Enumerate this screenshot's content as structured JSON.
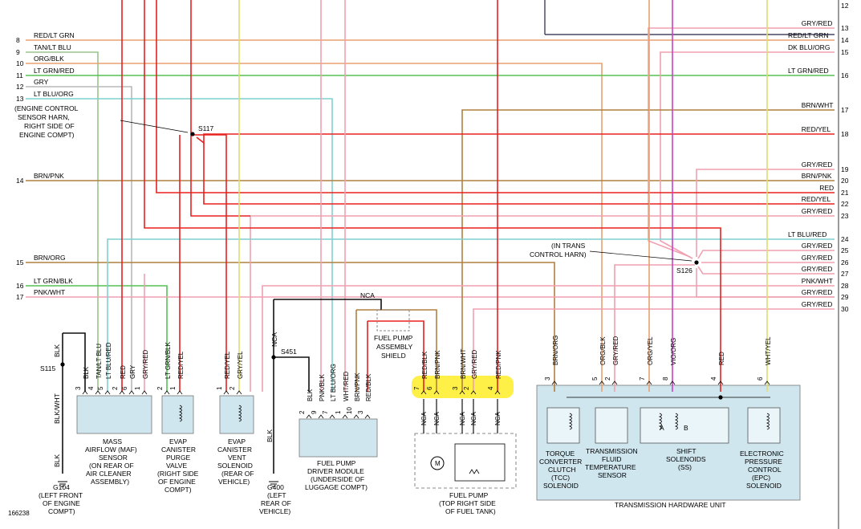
{
  "diagram_id": "166238",
  "colors": {
    "red": "#e8201f",
    "grn": "#55c255",
    "tan": "#9bc48a",
    "org": "#e8a070",
    "gry": "#b8b8b8",
    "blu": "#7ed0d0",
    "brn": "#b08040",
    "pnk": "#f0a0b0",
    "blk": "#111111",
    "vio": "#cc40cc",
    "yel": "#dede70",
    "box": "#cfe6ef",
    "highlight": "#ffee33",
    "dkblu": "#222244"
  },
  "left_wires": [
    {
      "num": "8",
      "label": "RED/LT GRN"
    },
    {
      "num": "9",
      "label": "TAN/LT BLU"
    },
    {
      "num": "10",
      "label": "ORG/BLK"
    },
    {
      "num": "11",
      "label": "LT GRN/RED"
    },
    {
      "num": "12",
      "label": "GRY"
    },
    {
      "num": "13",
      "label": "LT BLU/ORG"
    },
    {
      "num": "14",
      "label": "BRN/PNK"
    },
    {
      "num": "15",
      "label": "BRN/ORG"
    },
    {
      "num": "16",
      "label": "LT GRN/BLK"
    },
    {
      "num": "17",
      "label": "PNK/WHT"
    }
  ],
  "right_wires": [
    {
      "num": "12",
      "label": ""
    },
    {
      "num": "13",
      "label": "GRY/RED"
    },
    {
      "num": "14",
      "label": "RED/LT GRN"
    },
    {
      "num": "15",
      "label": "DK BLU/ORG"
    },
    {
      "num": "16",
      "label": "LT GRN/RED"
    },
    {
      "num": "17",
      "label": "BRN/WHT"
    },
    {
      "num": "18",
      "label": "RED/YEL"
    },
    {
      "num": "19",
      "label": "GRY/RED"
    },
    {
      "num": "20",
      "label": "BRN/PNK"
    },
    {
      "num": "21",
      "label": "RED"
    },
    {
      "num": "22",
      "label": "RED/YEL"
    },
    {
      "num": "23",
      "label": "GRY/RED"
    },
    {
      "num": "24",
      "label": "LT BLU/RED"
    },
    {
      "num": "25",
      "label": "GRY/RED"
    },
    {
      "num": "26",
      "label": "GRY/RED"
    },
    {
      "num": "27",
      "label": "GRY/RED"
    },
    {
      "num": "28",
      "label": "PNK/WHT"
    },
    {
      "num": "29",
      "label": "GRY/RED"
    },
    {
      "num": "30",
      "label": "GRY/RED"
    }
  ],
  "splices": {
    "s117": "S117",
    "s117_note": [
      "(ENGINE CONTROL",
      "SENSOR HARN,",
      "RIGHT SIDE OF",
      "ENGINE COMPT)"
    ],
    "s126": "S126",
    "s126_note": [
      "(IN TRANS",
      "CONTROL HARN)"
    ],
    "s115": "S115",
    "s451": "S451",
    "nca": "NCA"
  },
  "maf": {
    "pins": [
      {
        "num": "3",
        "wire": "BLK"
      },
      {
        "num": "4",
        "wire": "TAN/LT BLU"
      },
      {
        "num": "5",
        "wire": "LT BLU/RED"
      },
      {
        "num": "2",
        "wire": "RED"
      },
      {
        "num": "6",
        "wire": "GRY"
      },
      {
        "num": "1",
        "wire": "GRY/RED"
      }
    ],
    "caption": [
      "MASS",
      "AIRFLOW (MAF)",
      "SENSOR",
      "(ON REAR OF",
      "AIR CLEANER",
      "ASSEMBLY)"
    ]
  },
  "purge": {
    "pins": [
      {
        "num": "2",
        "wire": "LT GRN/BLK"
      },
      {
        "num": "1",
        "wire": "RED/YEL"
      }
    ],
    "caption": [
      "EVAP",
      "CANISTER",
      "PURGE",
      "VALVE",
      "(RIGHT SIDE",
      "OF ENGINE",
      "COMPT)"
    ]
  },
  "vent": {
    "pins": [
      {
        "num": "1",
        "wire": "RED/YEL"
      },
      {
        "num": "2",
        "wire": "GRY/YEL"
      }
    ],
    "caption": [
      "EVAP",
      "CANISTER",
      "VENT",
      "SOLENOID",
      "(REAR OF",
      "VEHICLE)"
    ]
  },
  "ground1": {
    "wire_top": "BLK",
    "wire_mid": "BLK/WHT",
    "wire_bot": "BLK",
    "label": "G104",
    "caption": [
      "(LEFT FRONT",
      "OF ENGINE",
      "COMPT)"
    ]
  },
  "ground2": {
    "wire_top": "NCA",
    "wire_bot": "BLK",
    "label": "G400",
    "caption": [
      "(LEFT",
      "REAR OF",
      "VEHICLE)"
    ]
  },
  "fpdm": {
    "pins": [
      {
        "num": "2",
        "wire": "BLK"
      },
      {
        "num": "9",
        "wire": "PNK/BLK"
      },
      {
        "num": "7",
        "wire": "LT BLU/ORG"
      },
      {
        "num": "1",
        "wire": "WHT/RED"
      },
      {
        "num": "10",
        "wire": "BRN/PNK"
      },
      {
        "num": "3",
        "wire": "RED/BLK"
      }
    ],
    "caption": [
      "FUEL PUMP",
      "DRIVER MODULE",
      "(UNDERSIDE OF",
      "LUGGAGE COMPT)"
    ]
  },
  "shield": {
    "caption": [
      "FUEL PUMP",
      "ASSEMBLY",
      "SHIELD"
    ]
  },
  "fuel_pump": {
    "pins": [
      {
        "num": "7",
        "wire": "RED/BLK",
        "bottom": "NCA"
      },
      {
        "num": "6",
        "wire": "BRN/PNK",
        "bottom": "NCA"
      },
      {
        "num": "3",
        "wire": "BRN/WHT",
        "bottom": "NCA"
      },
      {
        "num": "2",
        "wire": "GRY/RED",
        "bottom": "NCA"
      },
      {
        "num": "4",
        "wire": "RED/PNK",
        "bottom": "NCA"
      }
    ],
    "motor": "M",
    "caption": [
      "FUEL PUMP",
      "(TOP RIGHT SIDE",
      "OF FUEL TANK)"
    ]
  },
  "thu": {
    "pins": [
      {
        "num": "3",
        "wire": "BRN/ORG"
      },
      {
        "num": "5",
        "wire": "ORG/BLK"
      },
      {
        "num": "2",
        "wire": "GRY/RED"
      },
      {
        "num": "7",
        "wire": "ORG/YEL"
      },
      {
        "num": "8",
        "wire": "VIO/ORG"
      },
      {
        "num": "4",
        "wire": "RED"
      },
      {
        "num": "6",
        "wire": "WHT/YEL"
      }
    ],
    "tcc": [
      "TORQUE",
      "CONVERTER",
      "CLUTCH",
      "(TCC)",
      "SOLENOID"
    ],
    "tft": [
      "TRANSMISSION",
      "FLUID",
      "TEMPERATURE",
      "SENSOR"
    ],
    "ss": [
      "SHIFT",
      "SOLENOIDS",
      "(SS)"
    ],
    "ss_a": "A",
    "ss_b": "B",
    "epc": [
      "ELECTRONIC",
      "PRESSURE",
      "CONTROL",
      "(EPC)",
      "SOLENOID"
    ],
    "title": "TRANSMISSION HARDWARE UNIT"
  }
}
